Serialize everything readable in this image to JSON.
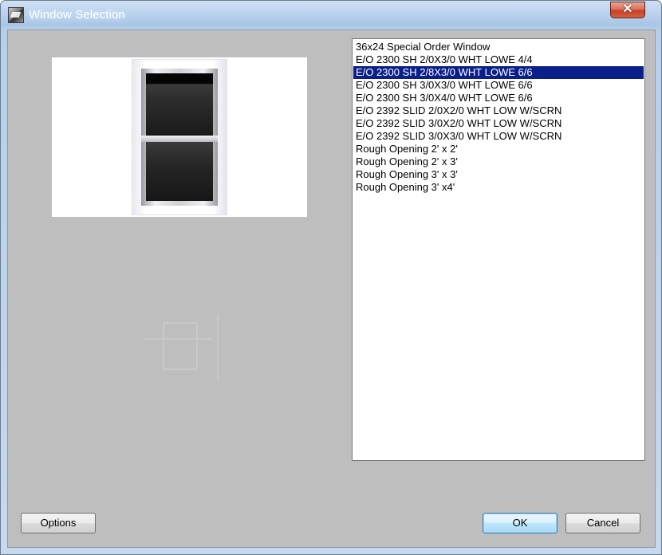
{
  "window": {
    "title": "Window Selection",
    "close_label": "✕"
  },
  "icons": {
    "app": "app-icon",
    "close": "close-icon"
  },
  "preview": {
    "description_icon": "double-hung-window-preview"
  },
  "list": {
    "selected_index": 2,
    "items": [
      "36x24 Special Order Window",
      "E/O 2300 SH 2/0X3/0 WHT LOWE 4/4",
      "E/O 2300 SH 2/8X3/0 WHT LOWE 6/6",
      "E/O 2300 SH 3/0X3/0 WHT LOWE 6/6",
      "E/O 2300 SH 3/0X4/0 WHT LOWE 6/6",
      "E/O 2392 SLID 2/0X2/0 WHT LOW W/SCRN",
      "E/O 2392 SLID 3/0X2/0 WHT LOW W/SCRN",
      "E/O 2392 SLID 3/0X3/0 WHT LOW W/SCRN",
      "Rough Opening 2' x 2'",
      "Rough Opening 2' x 3'",
      "Rough Opening 3' x 3'",
      "Rough Opening 3' x4'"
    ]
  },
  "buttons": {
    "options": "Options",
    "ok": "OK",
    "cancel": "Cancel"
  },
  "colors": {
    "selection": "#0a1f8a",
    "dialog_bg": "#bebebe",
    "close": "#c2412b"
  }
}
